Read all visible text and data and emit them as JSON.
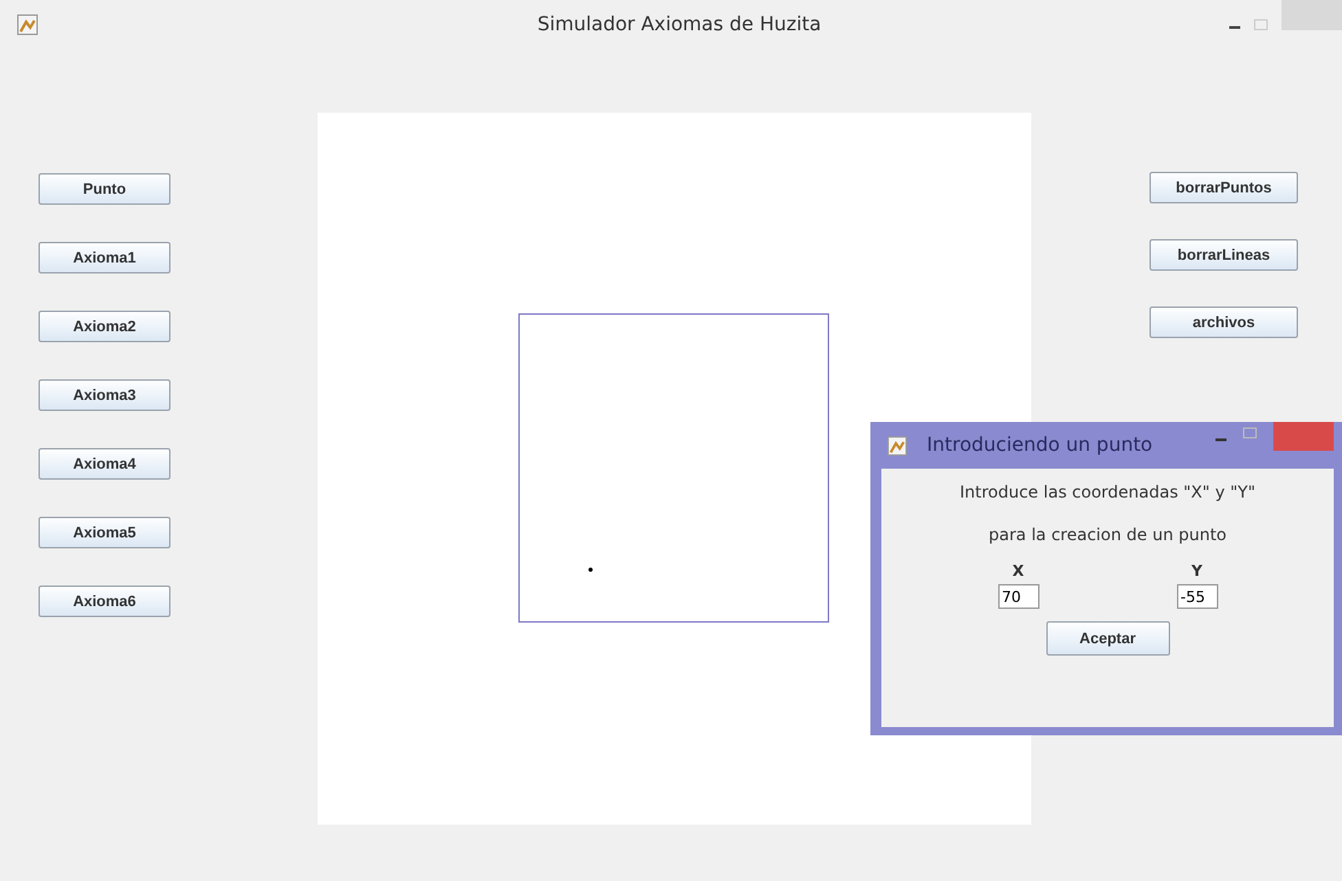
{
  "window": {
    "title": "Simulador Axiomas de Huzita"
  },
  "left_buttons": [
    "Punto",
    "Axioma1",
    "Axioma2",
    "Axioma3",
    "Axioma4",
    "Axioma5",
    "Axioma6"
  ],
  "right_buttons": [
    "borrarPuntos",
    "borrarLineas",
    "archivos"
  ],
  "dialog": {
    "title": "Introduciendo un punto",
    "lines": [
      "Introduce las coordenadas \"X\" y \"Y\"",
      "para la creacion de un punto"
    ],
    "fields": [
      {
        "label": "X",
        "value": "70"
      },
      {
        "label": "Y",
        "value": "-55"
      }
    ],
    "button": "Aceptar"
  }
}
